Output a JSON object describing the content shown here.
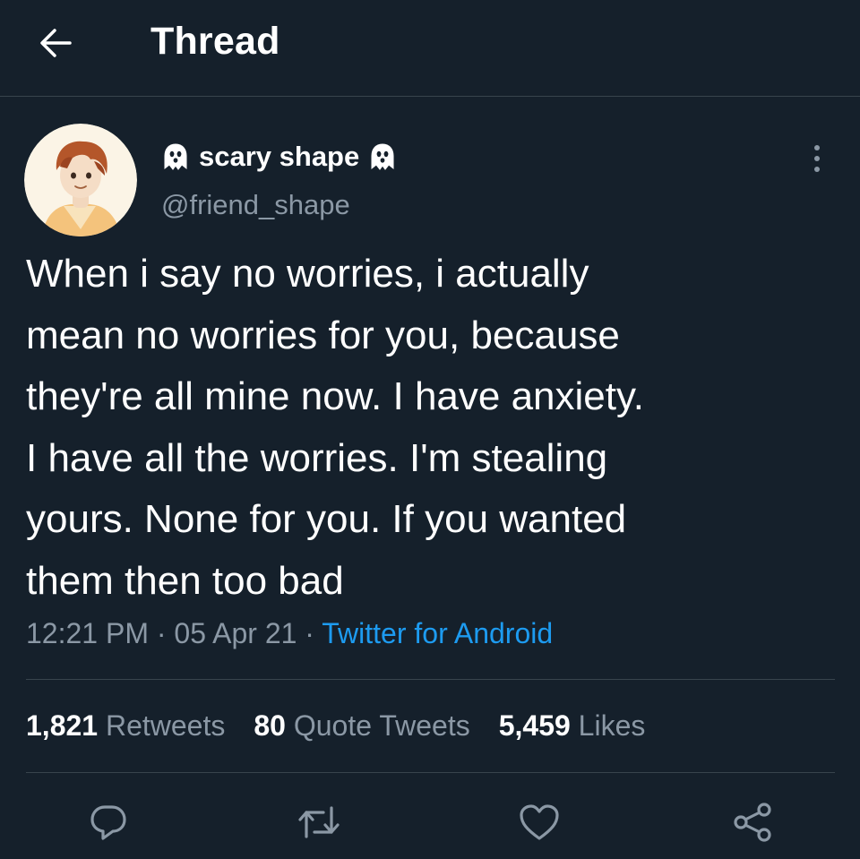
{
  "header": {
    "title": "Thread",
    "back_icon": "arrow-left-icon"
  },
  "tweet": {
    "author": {
      "display_name": "scary shape",
      "name_emoji": "ghost-icon",
      "handle": "@friend_shape",
      "avatar": "avatar-illustration"
    },
    "text": "When i say no worries, i actually\nmean no worries for you, because\nthey're all mine now. I have anxiety.\nI have all the worries. I'm stealing\nyours. None for you. If you wanted\nthem then too bad",
    "time": "12:21 PM",
    "date": "05 Apr 21",
    "separator": "·",
    "source": "Twitter for Android",
    "stats": {
      "retweets_count": "1,821",
      "retweets_label": "Retweets",
      "quote_count": "80",
      "quote_label": "Quote Tweets",
      "likes_count": "5,459",
      "likes_label": "Likes"
    }
  },
  "actions": {
    "reply_icon": "reply-icon",
    "retweet_icon": "retweet-icon",
    "like_icon": "heart-icon",
    "share_icon": "share-icon"
  },
  "colors": {
    "background": "#15202b",
    "text": "#ffffff",
    "secondary_text": "#8b98a5",
    "accent": "#1d9bf0",
    "divider": "#38444d"
  }
}
